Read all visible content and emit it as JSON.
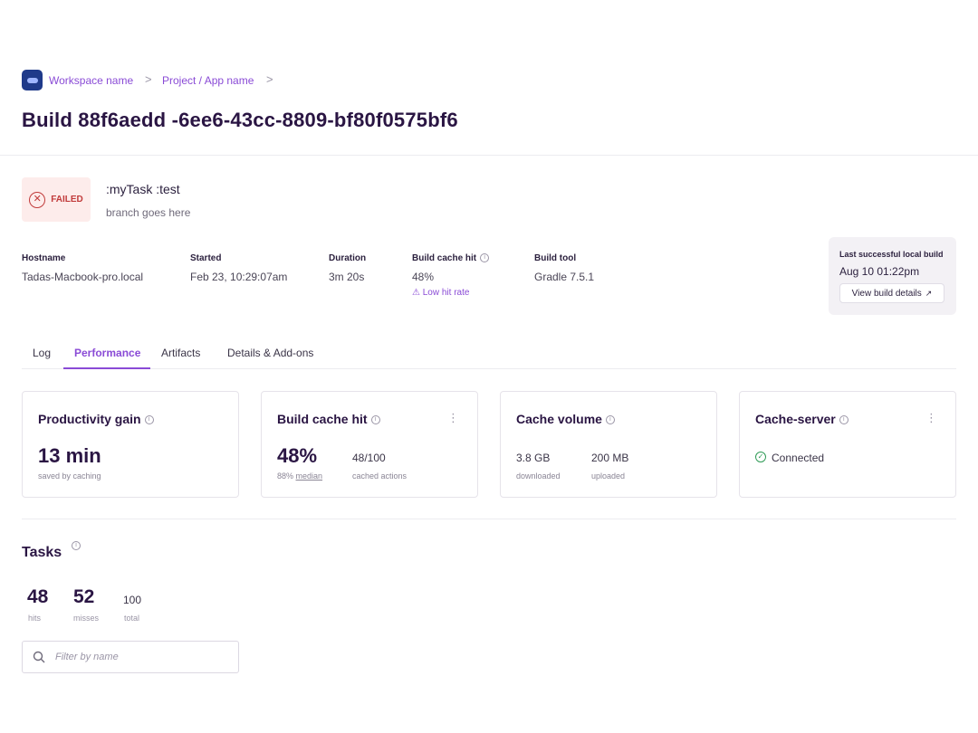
{
  "breadcrumb": {
    "workspace": "Workspace name",
    "project": "Project / App name",
    "separator": ">"
  },
  "page_title": "Build 88f6aedd -6ee6-43cc-8809-bf80f0575bf6",
  "status": {
    "label": "FAILED",
    "icon": "x-circle-icon",
    "color": "#c13b3b"
  },
  "task": {
    "name": ":myTask :test",
    "branch": "branch goes here"
  },
  "meta": {
    "hostname": {
      "label": "Hostname",
      "value": "Tadas-Macbook-pro.local"
    },
    "started": {
      "label": "Started",
      "value": "Feb 23, 10:29:07am"
    },
    "duration": {
      "label": "Duration",
      "value": "3m 20s"
    },
    "build_cache_hit": {
      "label": "Build cache hit",
      "value": "48%",
      "warning": "Low hit rate"
    },
    "build_tool": {
      "label": "Build tool",
      "value": "Gradle 7.5.1"
    }
  },
  "last_successful": {
    "label": "Last successful local build",
    "date": "Aug 10 01:22pm",
    "button": "View build details"
  },
  "tabs": [
    {
      "label": "Log",
      "active": false
    },
    {
      "label": "Performance",
      "active": true
    },
    {
      "label": "Artifacts",
      "active": false
    },
    {
      "label": "Details & Add-ons",
      "active": false
    }
  ],
  "cards": {
    "productivity": {
      "title": "Productivity gain",
      "value": "13 min",
      "caption": "saved by caching"
    },
    "cache_hit": {
      "title": "Build cache hit",
      "value": "48%",
      "median_prefix": "88%",
      "median_link": "median",
      "actions": "48/100",
      "actions_caption": "cached actions"
    },
    "cache_volume": {
      "title": "Cache volume",
      "downloaded": "3.8 GB",
      "downloaded_caption": "downloaded",
      "uploaded": "200 MB",
      "uploaded_caption": "uploaded"
    },
    "cache_server": {
      "title": "Cache-server",
      "status": "Connected"
    }
  },
  "tasks": {
    "title": "Tasks",
    "hits": "48",
    "hits_caption": "hits",
    "misses": "52",
    "misses_caption": "misses",
    "total": "100",
    "total_caption": "total",
    "filter_placeholder": "Filter by name"
  },
  "colors": {
    "accent": "#8a4bd6",
    "title": "#2a1543",
    "success": "#2e9a55",
    "error": "#c13b3b"
  }
}
